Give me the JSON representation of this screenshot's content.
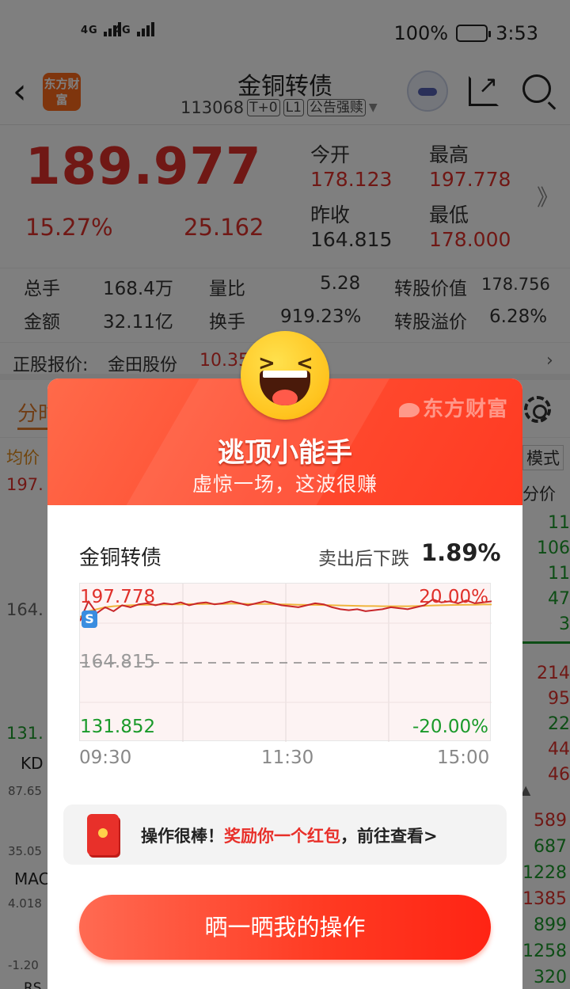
{
  "status_bar": {
    "sim1": "4G",
    "sim2": "4G",
    "battery_pct": "100%",
    "time": "3:53"
  },
  "header": {
    "logo": "东方财富",
    "title": "金铜转债",
    "code": "113068",
    "tags": [
      "T+0",
      "L1",
      "公告强赎"
    ]
  },
  "quote": {
    "price": "189.977",
    "change_pct": "15.27%",
    "change": "25.162",
    "open_label": "今开",
    "open": "178.123",
    "high_label": "最高",
    "high": "197.778",
    "prev_close_label": "昨收",
    "prev_close": "164.815",
    "low_label": "最低",
    "low": "178.000"
  },
  "stats": {
    "volume_label": "总手",
    "volume": "168.4万",
    "vol_ratio_label": "量比",
    "vol_ratio": "5.28",
    "conv_value_label": "转股价值",
    "conv_value": "178.756",
    "amount_label": "金额",
    "amount": "32.11亿",
    "turnover_label": "换手",
    "turnover": "919.23%",
    "premium_label": "转股溢价",
    "premium": "6.28%"
  },
  "underlying": {
    "label": "正股报价:",
    "name": "金田股份",
    "price": "10.35"
  },
  "background_chart": {
    "tab": "分时",
    "avg_label": "均价",
    "top_value": "197.",
    "mid_value": "164.",
    "low_value": "131.",
    "kdj_label": "KD",
    "kdj_value_top": "87.65",
    "kdj_value_bottom": "35.05",
    "macd_label": "MAC",
    "macd_top": "4.018",
    "macd_bottom": "-1.20",
    "rsi_label": "RS",
    "mode_label": "模式",
    "split_label": "分价",
    "orders": [
      {
        "v": "11",
        "c": "green"
      },
      {
        "v": "106",
        "c": "green"
      },
      {
        "v": "11",
        "c": "green"
      },
      {
        "v": "47",
        "c": "green"
      },
      {
        "v": "3",
        "c": "green"
      },
      {
        "v": "214",
        "c": "red"
      },
      {
        "v": "95",
        "c": "red"
      },
      {
        "v": "22",
        "c": "green"
      },
      {
        "v": "44",
        "c": "red"
      },
      {
        "v": "46",
        "c": "red"
      }
    ],
    "ticks": [
      {
        "v": "589",
        "c": "red"
      },
      {
        "v": "687",
        "c": "green"
      },
      {
        "v": "1228",
        "c": "green"
      },
      {
        "v": "1385",
        "c": "red"
      },
      {
        "v": "899",
        "c": "green"
      },
      {
        "v": "1258",
        "c": "green"
      },
      {
        "v": "320",
        "c": "green"
      }
    ]
  },
  "popup": {
    "brand": "东方财富",
    "title": "逃顶小能手",
    "subtitle": "虚惊一场，这波很赚",
    "stock_name": "金铜转债",
    "after_label": "卖出后下跌",
    "after_value": "1.89%",
    "reward_prefix": "操作很棒！",
    "reward_highlight": "奖励你一个红包",
    "reward_suffix": "，前往查看>",
    "share_button": "晒一晒我的操作"
  },
  "chart_data": {
    "type": "line",
    "x_ticks": [
      "09:30",
      "11:30",
      "15:00"
    ],
    "y_left_labels": [
      "197.778",
      "164.815",
      "131.852"
    ],
    "y_right_labels": [
      "20.00%",
      "-20.00%"
    ],
    "ylim": [
      131.852,
      197.778
    ],
    "reference_line": 164.815,
    "series": [
      {
        "name": "",
        "color": "#c8262a",
        "values": [
          186,
          196,
          190,
          193,
          191,
          194,
          193,
          194.5,
          195,
          194,
          195,
          194.5,
          195.5,
          194,
          195,
          195.5,
          194.5,
          195,
          196,
          195,
          194,
          195,
          196,
          195,
          194,
          193.5,
          193,
          194,
          195,
          194.5,
          193,
          192,
          191.5,
          192,
          191,
          191.5,
          192,
          193,
          192.5,
          192,
          193,
          194,
          197,
          195.5,
          196,
          195,
          196.5,
          195,
          195.5,
          196
        ]
      },
      {
        "name": "",
        "color": "#f0b43c",
        "values": [
          188,
          191,
          192,
          193,
          193.5,
          193.8,
          194,
          194.2,
          194.3,
          194.3,
          194.4,
          194.5,
          194.5,
          194.6,
          194.6,
          194.7,
          194.7,
          194.7,
          194.8,
          194.8,
          194.7,
          194.7,
          194.7,
          194.6,
          194.5,
          194.4,
          194.3,
          194.2,
          194.2,
          194.1,
          194,
          193.9,
          193.8,
          193.7,
          193.6,
          193.6,
          193.5,
          193.5,
          193.5,
          193.5,
          193.6,
          193.7,
          193.9,
          194,
          194.1,
          194.2,
          194.3,
          194.3,
          194.4,
          194.4
        ]
      }
    ]
  },
  "colors": {
    "up": "#e0302a",
    "down": "#1a9a2a",
    "accent": "#ff4a2e"
  }
}
